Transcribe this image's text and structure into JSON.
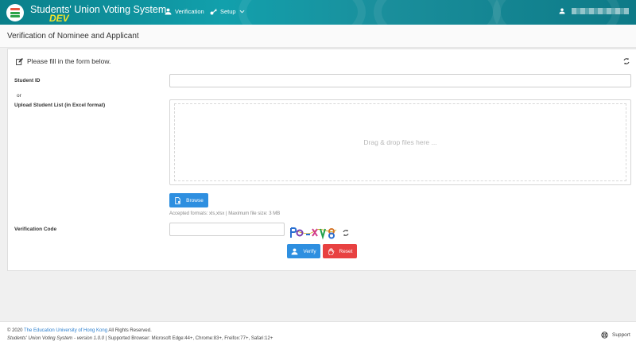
{
  "app": {
    "title": "Students' Union Voting System",
    "env": "DEV"
  },
  "nav": {
    "verification": "Verification",
    "setup": "Setup"
  },
  "page": {
    "title": "Verification of Nominee and Applicant"
  },
  "form": {
    "intro": "Please fill in the form below.",
    "student_id_label": "Student ID",
    "or": "or",
    "upload_label": "Upload Student List (in Excel format)",
    "dropzone_text": "Drag & drop files here ...",
    "browse_label": "Browse",
    "accepted_formats": "Accepted formats: xls,xlsx | Maximum file size: 3 MB",
    "verification_code_label": "Verification Code",
    "verify_label": "Verify",
    "reset_label": "Reset"
  },
  "footer": {
    "copyright_prefix": "© 2020",
    "university": "The Education University of Hong Kong",
    "rights": "All Rights Reserved.",
    "version": "Students' Union Voting System - version 1.0.0",
    "browsers": "| Supported Browser: Microsoft Edge:44+, Chrome:83+, Freifox:77+, Safari:12+",
    "support": "Support"
  },
  "colors": {
    "navbar": "#12a0ac",
    "primary": "#2e8fe0",
    "danger": "#e84141",
    "dev": "#f5e52a"
  }
}
